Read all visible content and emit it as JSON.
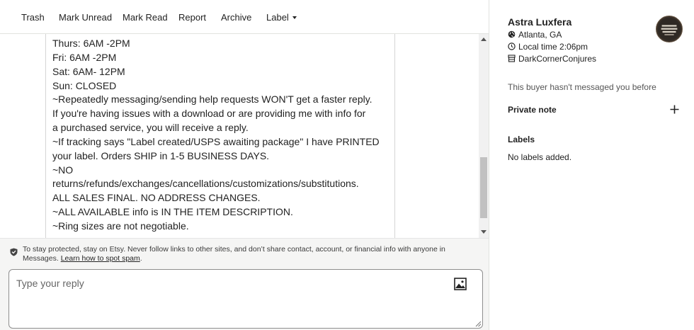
{
  "toolbar": {
    "trash": "Trash",
    "mark_unread": "Mark Unread",
    "mark_read": "Mark Read",
    "report": "Report",
    "archive": "Archive",
    "label": "Label"
  },
  "message": {
    "lines": [
      "Thurs: 6AM -2PM",
      "Fri: 6AM -2PM",
      "Sat: 6AM- 12PM",
      "Sun: CLOSED",
      "~Repeatedly messaging/sending help requests WON'T get a faster reply.",
      "If you're having issues with a download or are providing me with info for",
      "a purchased service, you will receive a reply.",
      "~If tracking says \"Label created/USPS awaiting package\" I have PRINTED",
      "your label. Orders SHIP in 1-5 BUSINESS DAYS.",
      "~NO",
      "returns/refunds/exchanges/cancellations/customizations/substitutions.",
      "ALL SALES FINAL. NO ADDRESS CHANGES.",
      "~ALL AVAILABLE info is IN THE ITEM DESCRIPTION.",
      "~Ring sizes are not negotiable."
    ]
  },
  "notice": {
    "text": "To stay protected, stay on Etsy. Never follow links to other sites, and don’t share contact, account, or financial info with anyone in Messages. ",
    "link": "Learn how to spot spam",
    "end": "."
  },
  "reply": {
    "placeholder": "Type your reply"
  },
  "buyer": {
    "name": "Astra Luxfera",
    "location": "Atlanta, GA",
    "local_time": "Local time 2:06pm",
    "shop": "DarkCornerConjures",
    "history": "This buyer hasn't messaged you before"
  },
  "private_note": {
    "title": "Private note"
  },
  "labels": {
    "title": "Labels",
    "empty": "No labels added."
  },
  "icons": {
    "shield": "shield-icon",
    "image": "image-icon",
    "location": "globe-icon",
    "time": "clock-icon",
    "shop": "shop-icon",
    "plus": "plus-icon",
    "caret": "caret-down-icon"
  }
}
